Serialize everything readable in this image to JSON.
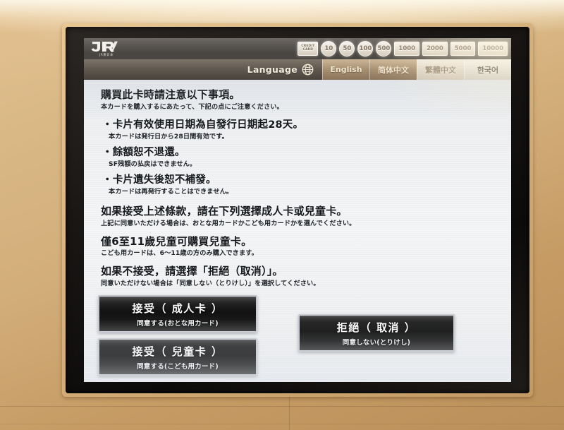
{
  "screen": {
    "header": {
      "logo_text": "JR",
      "logo_sub": "JR東日本",
      "denominations": [
        {
          "label": "CREDIT CARD",
          "shape": "card"
        },
        {
          "label": "10",
          "shape": "circle"
        },
        {
          "label": "50",
          "shape": "circle"
        },
        {
          "label": "100",
          "shape": "circle"
        },
        {
          "label": "500",
          "shape": "circle"
        },
        {
          "label": "1000",
          "shape": "rect"
        },
        {
          "label": "2000",
          "shape": "rect"
        },
        {
          "label": "5000",
          "shape": "rect"
        },
        {
          "label": "10000",
          "shape": "rect"
        }
      ]
    },
    "language_bar": {
      "label": "Language",
      "icon": "globe-icon",
      "tabs": [
        {
          "label": "English",
          "selected": false
        },
        {
          "label": "简体中文",
          "selected": false
        },
        {
          "label": "繁體中文",
          "selected": true
        },
        {
          "label": "한국어",
          "selected": false
        }
      ]
    },
    "content": {
      "title_zh": "購買此卡時請注意以下事項。",
      "title_ja": "本カードを購入するにあたって、下記の点にご注意ください。",
      "notices": [
        {
          "zh": "・卡片有效使用日期為自發行日期起28天。",
          "ja": "本カードは発行日から28日間有効です。"
        },
        {
          "zh": "・餘額恕不退還。",
          "ja": "SF残額の払戻はできません。"
        },
        {
          "zh": "・卡片遺失後恕不補發。",
          "ja": "本カードは再発行することはできません。"
        }
      ],
      "instructions": [
        {
          "zh": "如果接受上述條款，請在下列選擇成人卡或兒童卡。",
          "ja": "上記に同意いただける場合は、おとな用カードかこども用カードかを選んでください。"
        },
        {
          "zh": "僅6至11歲兒童可購買兒童卡。",
          "ja": "こども用カードは、6～11歳の方のみ購入できます。"
        },
        {
          "zh": "如果不接受，請選擇「拒絕（取消）」。",
          "ja": "同意いただけない場合は「同意しない（とりけし）」を選択してください。"
        }
      ]
    },
    "buttons": {
      "accept_adult": {
        "line1": "接受（ 成人卡 ）",
        "line2": "同意する(おとな用カード)"
      },
      "accept_child": {
        "line1": "接受（ 兒童卡 ）",
        "line2": "同意する(こども用カード)"
      },
      "decline": {
        "line1": "拒絕（ 取消 ）",
        "line2": "同意しない(とりけし)"
      }
    }
  },
  "colors": {
    "machine_body": "#d2ad79",
    "bezel": "#191614",
    "screen_bg": "#f1f3f5",
    "header_bar": "#332e29",
    "language_bar": "#564d43",
    "button_face": "#1b1b1b",
    "button_border": "#c8ccd2"
  }
}
